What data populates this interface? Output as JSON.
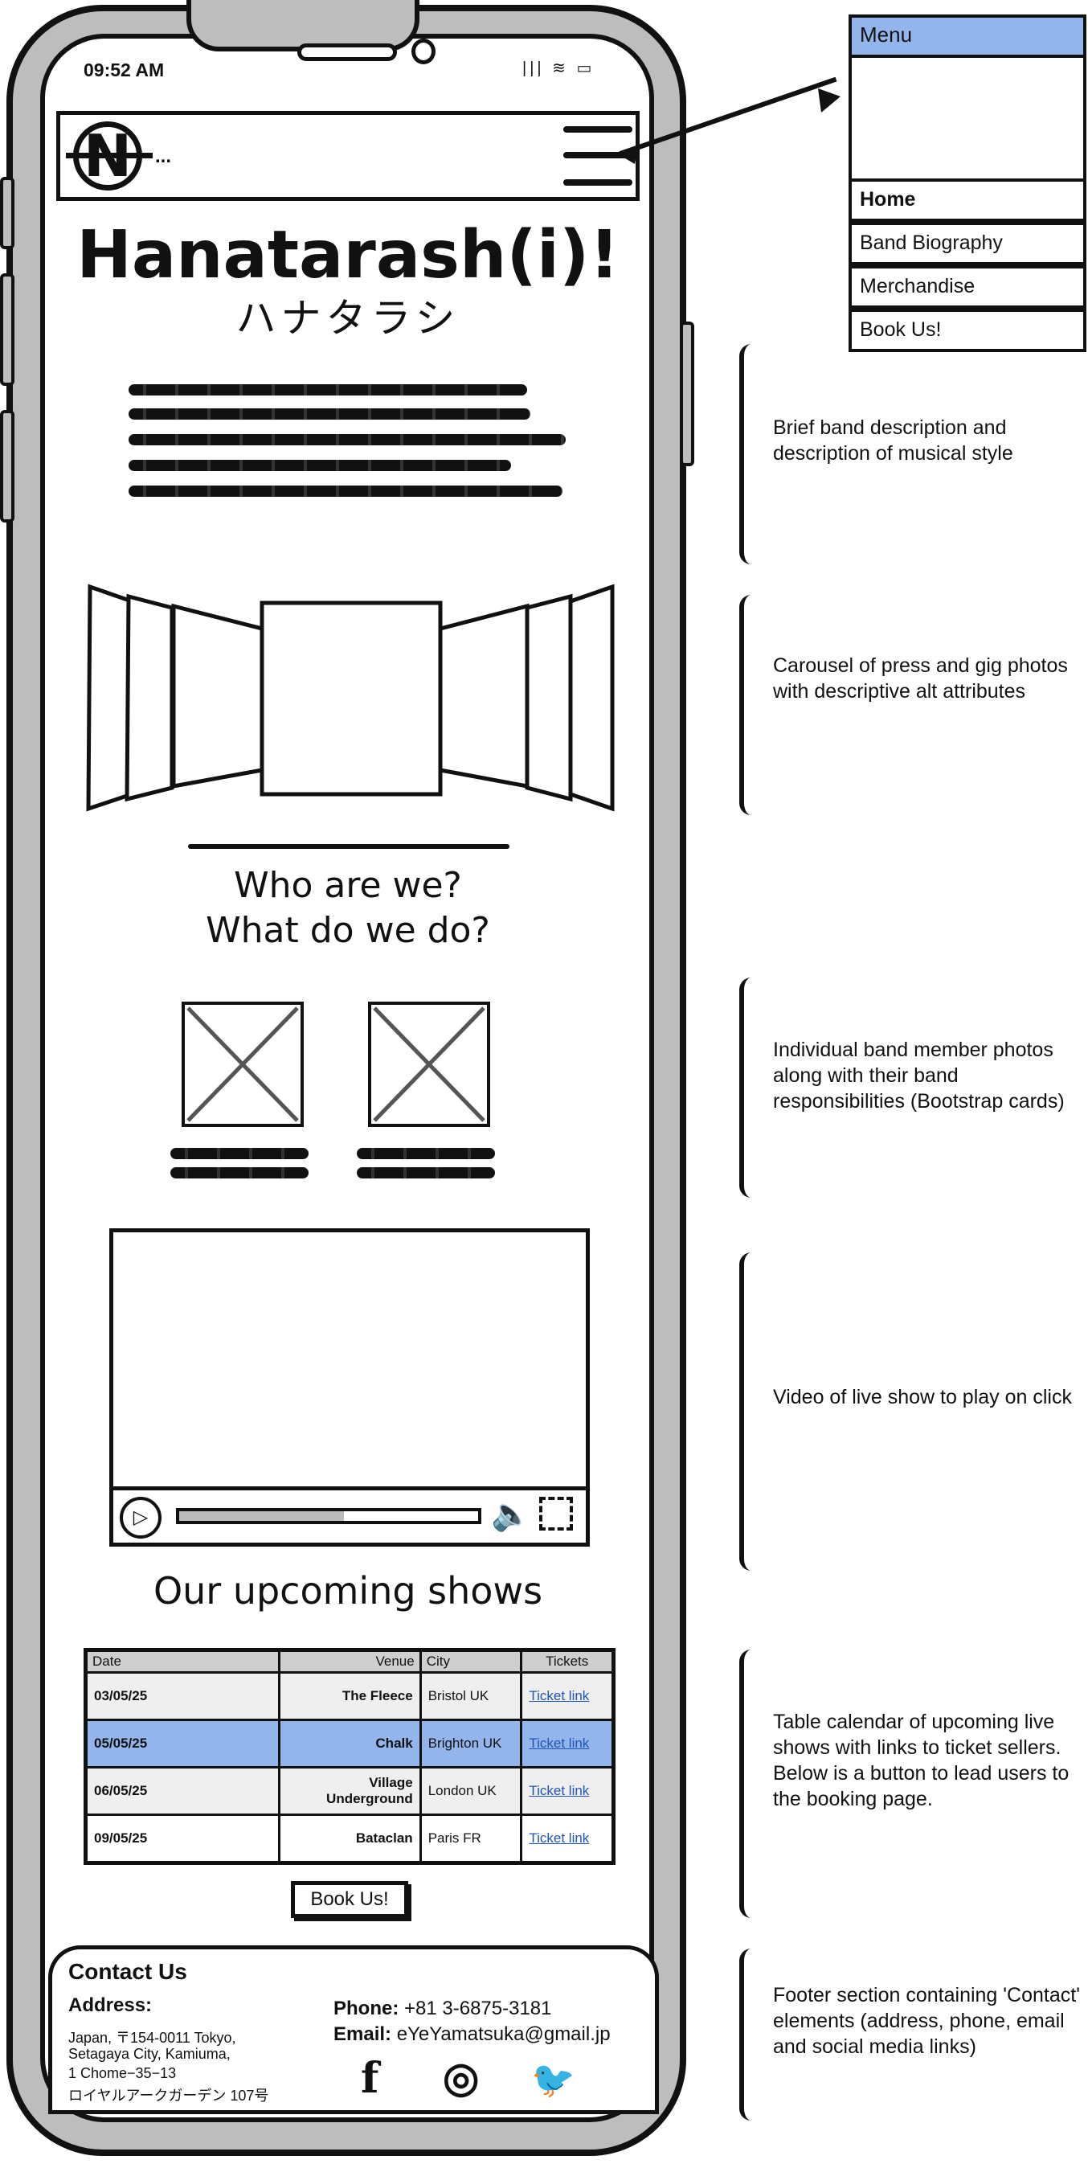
{
  "status_bar": {
    "time": "09:52 AM",
    "icons": "|||  ≋  ▭"
  },
  "navbar": {
    "logo_letter": "N",
    "brand_text": "..."
  },
  "hero": {
    "title": "Hanatarash(i)!",
    "subtitle": "ハナタラシ"
  },
  "about": {
    "heading_line1": "Who are we?",
    "heading_line2": "What do we do?"
  },
  "shows": {
    "title": "Our upcoming shows",
    "columns": [
      "Date",
      "Venue",
      "City",
      "Tickets"
    ],
    "rows": [
      {
        "date": "03/05/25",
        "venue": "The Fleece",
        "city": "Bristol UK",
        "tickets": "Ticket link"
      },
      {
        "date": "05/05/25",
        "venue": "Chalk",
        "city": "Brighton UK",
        "tickets": "Ticket link"
      },
      {
        "date": "06/05/25",
        "venue": "Village Underground",
        "city": "London UK",
        "tickets": "Ticket link"
      },
      {
        "date": "09/05/25",
        "venue": "Bataclan",
        "city": "Paris FR",
        "tickets": "Ticket link"
      }
    ],
    "book_button": "Book Us!"
  },
  "video": {
    "progress_fraction": 0.55
  },
  "footer": {
    "title": "Contact Us",
    "address_label": "Address:",
    "address_lines": [
      "Japan, 〒154-0011 Tokyo,",
      "Setagaya City, Kamiuma,",
      "1 Chome−35−13",
      "ロイヤルアークガーデン 107号"
    ],
    "phone_label": "Phone:",
    "phone_value": "+81 3-6875-3181",
    "email_label": "Email:",
    "email_value": "eYeYamatsuka@gmail.jp",
    "social": {
      "facebook": "f",
      "instagram": "◎",
      "twitter": "🐦"
    }
  },
  "menu": {
    "header": "Menu",
    "items": [
      "Home",
      "Band Biography",
      "Merchandise",
      "Book Us!"
    ]
  },
  "annotations": {
    "description": "Brief band description and description of musical style",
    "carousel": "Carousel of press and gig photos with descriptive alt attributes",
    "members": "Individual band member photos along with their band responsibilities (Bootstrap cards)",
    "video": "Video of live show to play on click",
    "table": "Table calendar of upcoming live shows with links to ticket sellers. Below is a button to lead users to the booking page.",
    "footer": "Footer section containing 'Contact' elements (address, phone, email and social media links)"
  },
  "colors": {
    "highlight": "#93b5ec",
    "frame": "#bdbdbd",
    "link": "#1f55b5"
  }
}
